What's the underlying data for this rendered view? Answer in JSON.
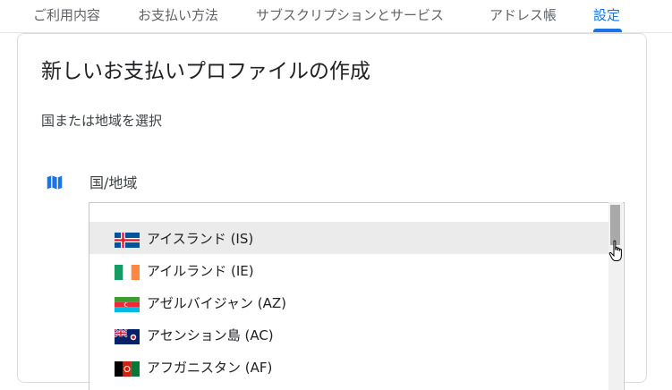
{
  "nav": {
    "tabs": [
      {
        "label": "ご利用内容"
      },
      {
        "label": "お支払い方法"
      },
      {
        "label": "サブスクリプションとサービス"
      },
      {
        "label": "アドレス帳"
      },
      {
        "label": "設定"
      }
    ],
    "active_tab": "設定"
  },
  "card": {
    "title": "新しいお支払いプロファイルの作成",
    "subtitle": "国または地域を選択"
  },
  "country_field": {
    "icon": "map-icon",
    "label": "国/地域"
  },
  "dropdown": {
    "options": [
      {
        "label": "アイスランド (IS)",
        "flag": "iceland",
        "highlighted": true
      },
      {
        "label": "アイルランド (IE)",
        "flag": "ireland",
        "highlighted": false
      },
      {
        "label": "アゼルバイジャン (AZ)",
        "flag": "azerbaijan",
        "highlighted": false
      },
      {
        "label": "アセンション島 (AC)",
        "flag": "ascension",
        "highlighted": false
      },
      {
        "label": "アフガニスタン (AF)",
        "flag": "afghanistan",
        "highlighted": false
      }
    ]
  },
  "colors": {
    "accent": "#1a73e8",
    "highlight_row": "#ebebeb",
    "border": "#dadce0"
  }
}
